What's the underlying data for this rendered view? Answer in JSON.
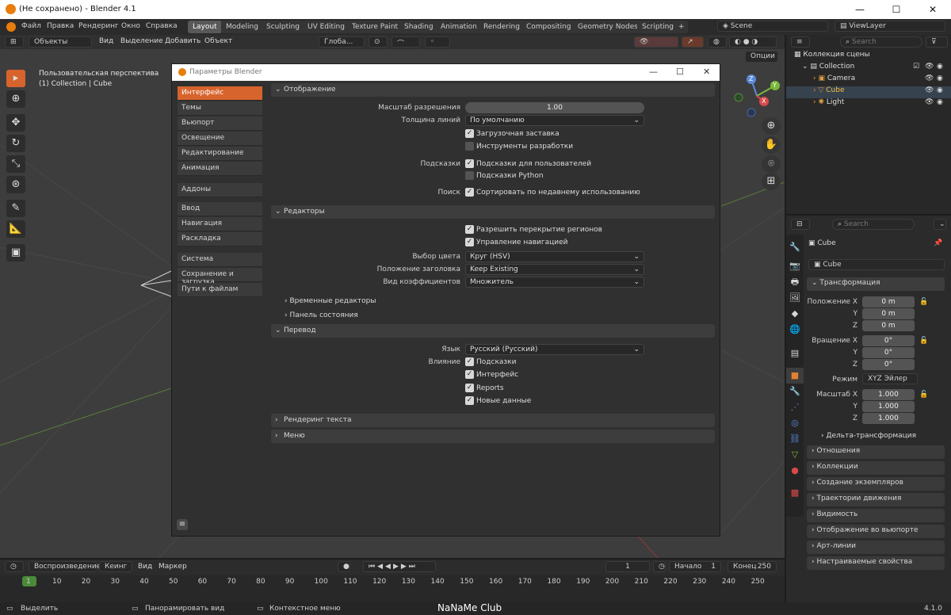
{
  "titlebar": {
    "title": "(Не сохранено) - Blender 4.1",
    "minimize": "—",
    "maximize": "☐",
    "close": "✕"
  },
  "menu": [
    "Файл",
    "Правка",
    "Рендеринг",
    "Окно",
    "Справка"
  ],
  "workspaces": [
    "Layout",
    "Modeling",
    "Sculpting",
    "UV Editing",
    "Texture Paint",
    "Shading",
    "Animation",
    "Rendering",
    "Compositing",
    "Geometry Nodes",
    "Scripting"
  ],
  "active_workspace": "Layout",
  "scene": "Scene",
  "viewlayer": "ViewLayer",
  "viewport_header": {
    "mode": "Объекты",
    "view": "Вид",
    "select": "Выделение",
    "add": "Добавить",
    "object": "Объект",
    "orientation": "Глоба...",
    "options": "Опции"
  },
  "viewport": {
    "perspective": "Пользовательская перспектива",
    "collection_info": "(1) Collection | Cube"
  },
  "gizmo": {
    "x": "X",
    "y": "Y",
    "z": "Z"
  },
  "outliner": {
    "search_placeholder": "Search",
    "items": [
      {
        "label": "Коллекция сцены"
      },
      {
        "label": "Collection"
      },
      {
        "label": "Camera"
      },
      {
        "label": "Cube"
      },
      {
        "label": "Light"
      }
    ]
  },
  "properties": {
    "search_placeholder": "Search",
    "object_name": "Cube",
    "object_field": "Cube",
    "transform": "Трансформация",
    "location_label": "Положение X",
    "location": [
      "0 m",
      "0 m",
      "0 m"
    ],
    "rotation_label": "Вращение X",
    "rotation": [
      "0°",
      "0°",
      "0°"
    ],
    "mode_label": "Режим",
    "mode_value": "XYZ Эйлер",
    "scale_label": "Масштаб X",
    "scale": [
      "1.000",
      "1.000",
      "1.000"
    ],
    "axis_y": "Y",
    "axis_z": "Z",
    "delta": "Дельта-трансформация",
    "panels": [
      "Отношения",
      "Коллекции",
      "Создание экземпляров",
      "Траектории движения",
      "Видимость",
      "Отображение во вьюпорте",
      "Арт-линии",
      "Настраиваемые свойства"
    ]
  },
  "prefs": {
    "title": "Параметры Blender",
    "nav_group1": [
      "Интерфейс",
      "Темы",
      "Вьюпорт",
      "Освещение",
      "Редактирование",
      "Анимация"
    ],
    "nav_group2": [
      "Аддоны"
    ],
    "nav_group3": [
      "Ввод",
      "Навигация",
      "Раскладка"
    ],
    "nav_group4": [
      "Система",
      "Сохранение и загрузка",
      "Пути к файлам"
    ],
    "sec_display": "Отображение",
    "res_scale_label": "Масштаб разрешения",
    "res_scale": "1.00",
    "line_width_label": "Толщина линий",
    "line_width": "По умолчанию",
    "splash": "Загрузочная заставка",
    "dev_tools": "Инструменты разработки",
    "tooltips_label": "Подсказки",
    "user_tooltips": "Подсказки для пользователей",
    "python_tooltips": "Подсказки Python",
    "search_label": "Поиск",
    "sort_recent": "Сортировать по недавнему использованию",
    "sec_editors": "Редакторы",
    "region_overlap": "Разрешить перекрытие регионов",
    "nav_controls": "Управление навигацией",
    "color_picker_label": "Выбор цвета",
    "color_picker": "Круг (HSV)",
    "header_pos_label": "Положение заголовка",
    "header_pos": "Keep Existing",
    "factor_label": "Вид коэффициентов",
    "factor": "Множитель",
    "temp_editors": "Временные редакторы",
    "status_bar": "Панель состояния",
    "sec_translation": "Перевод",
    "language_label": "Язык",
    "language": "Русский (Русский)",
    "affect_label": "Влияние",
    "tr_tooltips": "Подсказки",
    "tr_interface": "Интерфейс",
    "tr_reports": "Reports",
    "tr_newdata": "Новые данные",
    "sec_text_render": "Рендеринг текста",
    "sec_menus": "Меню"
  },
  "timeline": {
    "playback": "Воспроизведение",
    "keying": "Кеинг",
    "view": "Вид",
    "marker": "Маркер",
    "current_frame": "1",
    "start_label": "Начало",
    "start": "1",
    "end_label": "Конец",
    "end": "250",
    "ticks": [
      "1",
      "10",
      "20",
      "30",
      "40",
      "50",
      "60",
      "70",
      "80",
      "90",
      "100",
      "110",
      "120",
      "130",
      "140",
      "150",
      "160",
      "170",
      "180",
      "190",
      "200",
      "210",
      "220",
      "230",
      "240",
      "250"
    ]
  },
  "statusbar": {
    "select": "Выделить",
    "pan": "Панорамировать вид",
    "context": "Контекстное меню",
    "version": "4.1.0"
  },
  "watermark": "NaNaMe Club"
}
